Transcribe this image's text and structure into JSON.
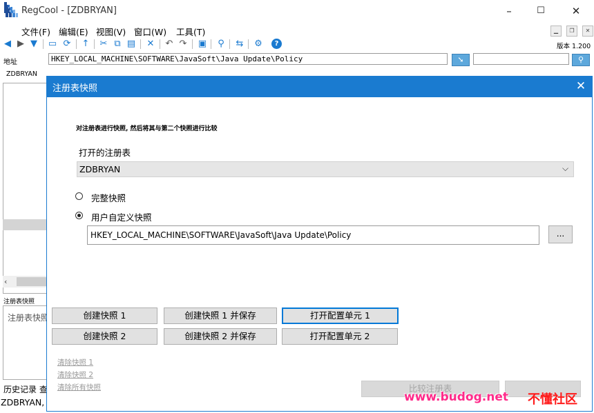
{
  "window": {
    "title": "RegCool - [ZDBRYAN]",
    "controls": {
      "minimize": "–",
      "maximize": "☐",
      "close": "✕"
    }
  },
  "menu": {
    "items": [
      "文件(F)",
      "编辑(E)",
      "视图(V)",
      "窗口(W)",
      "工具(T)"
    ]
  },
  "toolbar": {
    "version": "版本 1.200"
  },
  "address": {
    "label": "地址",
    "value": "HKEY_LOCAL_MACHINE\\SOFTWARE\\JavaSoft\\Java Update\\Policy",
    "search_value": ""
  },
  "left": {
    "tab": "ZDBRYAN",
    "snapshot_panel_label": "注册表快照",
    "snapshot_panel_text": "注册表快照",
    "history_tab": "历史记录  查找",
    "status": "ZDBRYAN,"
  },
  "dialog": {
    "title": "注册表快照",
    "description": "对注册表进行快照, 然后将其与第二个快照进行比较",
    "open_registry_label": "打开的注册表",
    "open_registry_value": "ZDBRYAN",
    "radio_full": "完整快照",
    "radio_custom": "用户自定义快照",
    "radio_selected": "custom",
    "custom_path": "HKEY_LOCAL_MACHINE\\SOFTWARE\\JavaSoft\\Java Update\\Policy",
    "browse": "...",
    "buttons": {
      "snap1": "创建快照 1",
      "snap1_save": "创建快照 1 并保存",
      "open_hive1": "打开配置单元 1",
      "snap2": "创建快照 2",
      "snap2_save": "创建快照 2 并保存",
      "open_hive2": "打开配置单元 2",
      "compare": "比较注册表"
    },
    "links": {
      "clear1": "清除快照 1",
      "clear2": "清除快照 2",
      "clear_all": "清除所有快照"
    }
  },
  "watermark": {
    "site": "www.budog.net",
    "name": "不懂社区"
  }
}
